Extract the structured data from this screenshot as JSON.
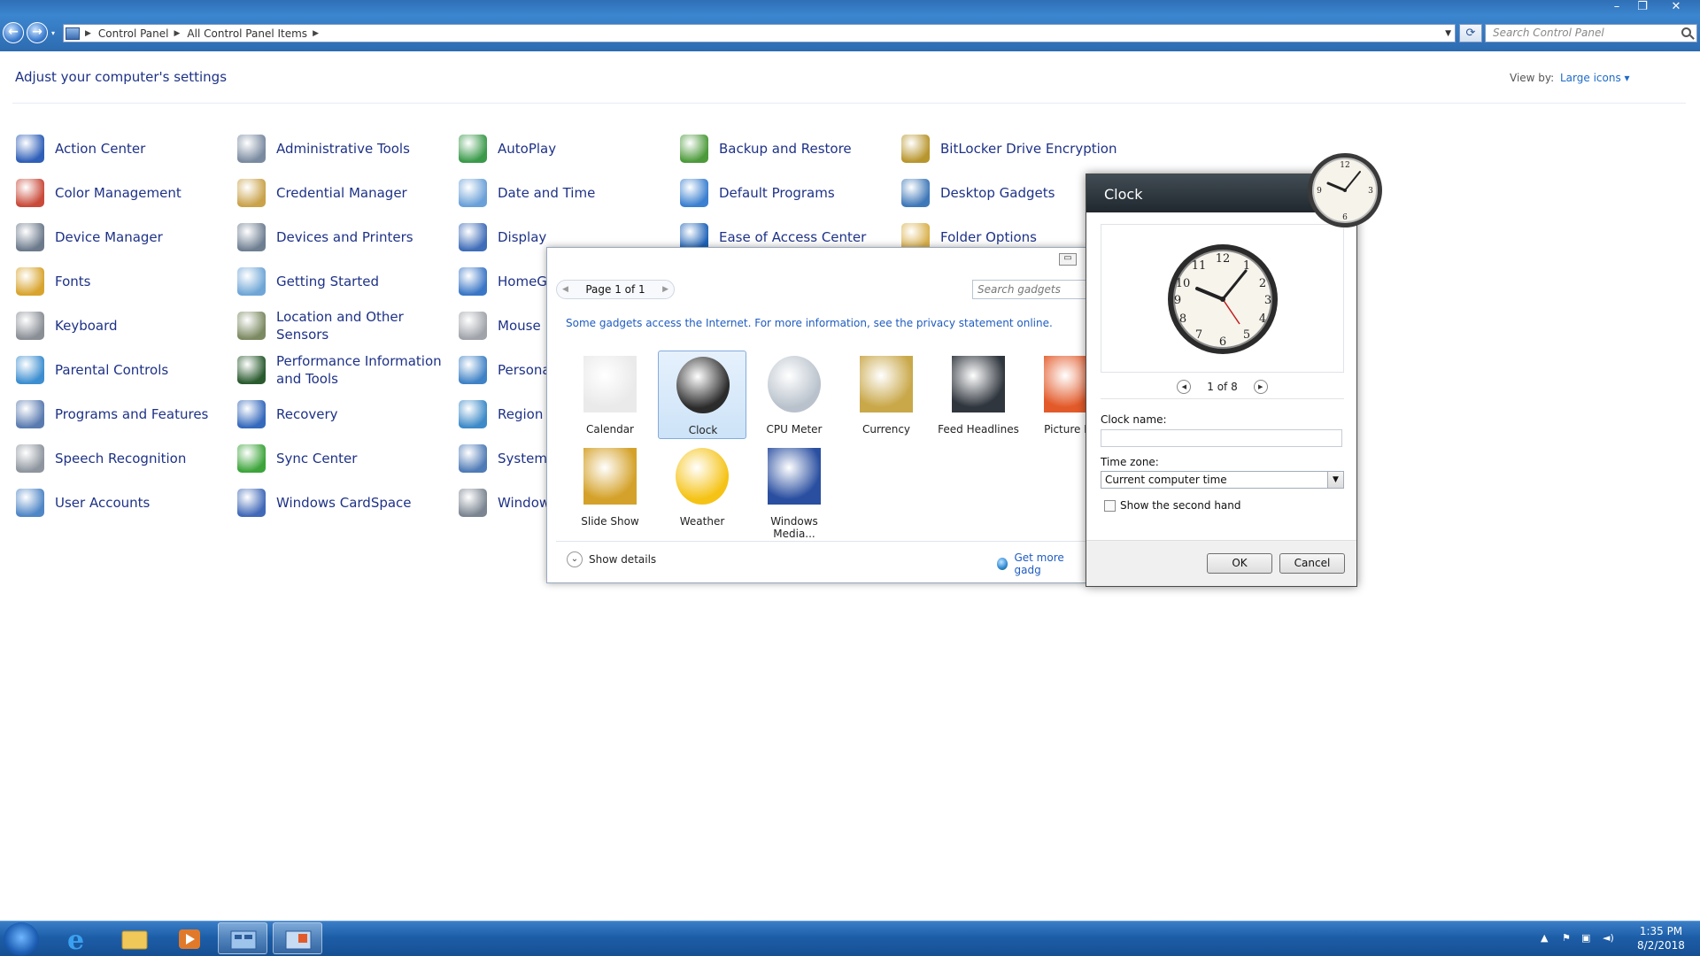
{
  "window": {
    "minimize_glyph": "–",
    "maximize_glyph": "❐",
    "close_glyph": "✕"
  },
  "address": {
    "crumbs": [
      "Control Panel",
      "All Control Panel Items"
    ],
    "search_placeholder": "Search Control Panel"
  },
  "header": {
    "title": "Adjust your computer's settings",
    "view_by_label": "View by:",
    "view_by_value": "Large icons ▾"
  },
  "items": [
    {
      "label": "Action Center",
      "color": "#2f5fb8"
    },
    {
      "label": "Administrative Tools",
      "color": "#7a8aa0"
    },
    {
      "label": "AutoPlay",
      "color": "#3a9a4a"
    },
    {
      "label": "Backup and Restore",
      "color": "#4c9a3b"
    },
    {
      "label": "BitLocker Drive Encryption",
      "color": "#b8962e"
    },
    {
      "label": "Color Management",
      "color": "#c94a3a"
    },
    {
      "label": "Credential Manager",
      "color": "#c9a24a"
    },
    {
      "label": "Date and Time",
      "color": "#6aa0d8"
    },
    {
      "label": "Default Programs",
      "color": "#3a7fd0"
    },
    {
      "label": "Desktop Gadgets",
      "color": "#3f78b8"
    },
    {
      "label": "Device Manager",
      "color": "#6c7a8c"
    },
    {
      "label": "Devices and Printers",
      "color": "#6f7f92"
    },
    {
      "label": "Display",
      "color": "#3f6db8"
    },
    {
      "label": "Ease of Access Center",
      "color": "#1e63b8"
    },
    {
      "label": "Folder Options",
      "color": "#d9b04a"
    },
    {
      "label": "Fonts",
      "color": "#d8a42e"
    },
    {
      "label": "Getting Started",
      "color": "#6fa6d6"
    },
    {
      "label": "HomeG",
      "color": "#3a76c6"
    },
    {
      "label": "Keyboard",
      "color": "#8a8f96"
    },
    {
      "label": "Location and Other Sensors",
      "color": "#7c8a62"
    },
    {
      "label": "Mouse",
      "color": "#a0a4aa"
    },
    {
      "label": "Parental Controls",
      "color": "#3c8ed0"
    },
    {
      "label": "Performance Information and Tools",
      "color": "#2a5b2f"
    },
    {
      "label": "Persona",
      "color": "#3f82c6"
    },
    {
      "label": "Programs and Features",
      "color": "#5a7bb0"
    },
    {
      "label": "Recovery",
      "color": "#3569bc"
    },
    {
      "label": "Region",
      "color": "#3d8ac8"
    },
    {
      "label": "Speech Recognition",
      "color": "#8e959e"
    },
    {
      "label": "Sync Center",
      "color": "#3ca43a"
    },
    {
      "label": "System",
      "color": "#4f7bb6"
    },
    {
      "label": "User Accounts",
      "color": "#4f86c6"
    },
    {
      "label": "Windows CardSpace",
      "color": "#4169b8"
    },
    {
      "label": "Window",
      "color": "#7b8591"
    }
  ],
  "gallery": {
    "page_label": "Page 1 of 1",
    "search_placeholder": "Search gadgets",
    "info_text": "Some gadgets access the Internet.  For more information, see the privacy statement online.",
    "gadgets": [
      {
        "label": "Calendar",
        "selected": false
      },
      {
        "label": "Clock",
        "selected": true
      },
      {
        "label": "CPU Meter",
        "selected": false
      },
      {
        "label": "Currency",
        "selected": false
      },
      {
        "label": "Feed Headlines",
        "selected": false
      },
      {
        "label": "Picture Pu",
        "selected": false
      },
      {
        "label": "Slide Show",
        "selected": false
      },
      {
        "label": "Weather",
        "selected": false
      },
      {
        "label": "Windows Media...",
        "selected": false
      }
    ],
    "show_details": "Show details",
    "get_more": "Get more gadg"
  },
  "clock_dialog": {
    "title": "Clock",
    "pager": "1 of 8",
    "clock_name_label": "Clock name:",
    "clock_name_value": "",
    "timezone_label": "Time zone:",
    "timezone_value": "Current computer time",
    "second_hand_label": "Show the second hand",
    "second_hand_checked": false,
    "ok": "OK",
    "cancel": "Cancel"
  },
  "taskbar": {
    "time": "1:35 PM",
    "date": "8/2/2018"
  }
}
